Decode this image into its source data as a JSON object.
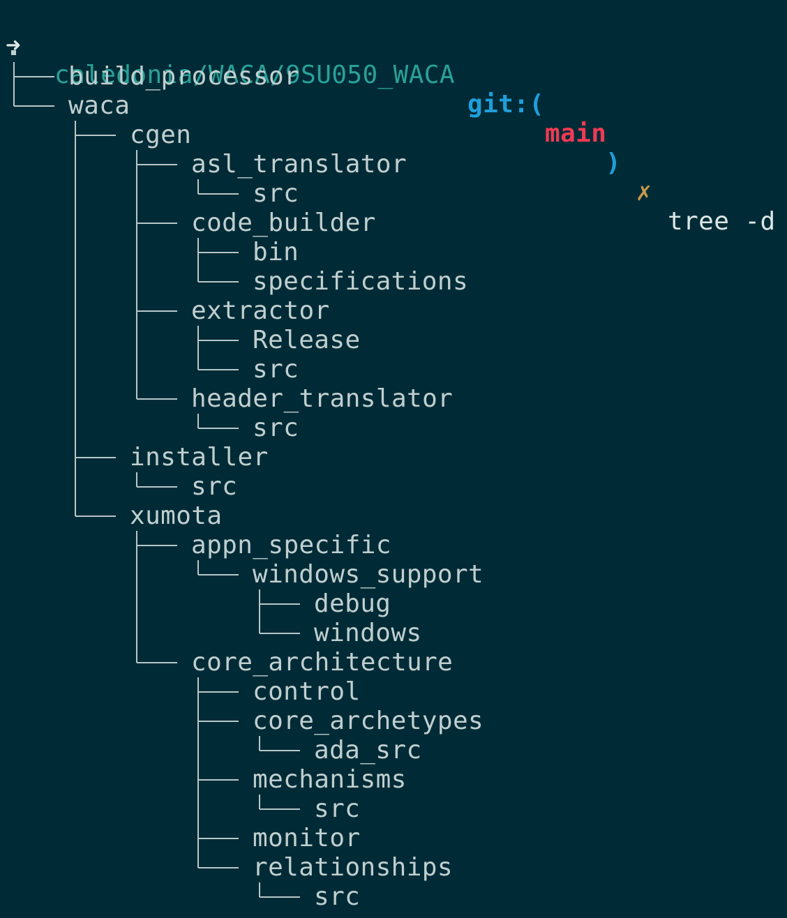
{
  "prompt": {
    "arrow": "➜",
    "path": "caledonia/WACA/9SU050_WACA",
    "git_label": "git:(",
    "branch": "main",
    "git_close": ")",
    "dirty_marker": "✗",
    "command": "tree -d"
  },
  "tree": {
    "root": ".",
    "entries": [
      {
        "depth": 0,
        "name": "build_processor",
        "last": false
      },
      {
        "depth": 0,
        "name": "waca",
        "last": true
      },
      {
        "depth": 1,
        "name": "cgen",
        "last": false
      },
      {
        "depth": 2,
        "name": "asl_translator",
        "last": false
      },
      {
        "depth": 3,
        "name": "src",
        "last": true
      },
      {
        "depth": 2,
        "name": "code_builder",
        "last": false
      },
      {
        "depth": 3,
        "name": "bin",
        "last": false
      },
      {
        "depth": 3,
        "name": "specifications",
        "last": true
      },
      {
        "depth": 2,
        "name": "extractor",
        "last": false
      },
      {
        "depth": 3,
        "name": "Release",
        "last": false
      },
      {
        "depth": 3,
        "name": "src",
        "last": true
      },
      {
        "depth": 2,
        "name": "header_translator",
        "last": true
      },
      {
        "depth": 3,
        "name": "src",
        "last": true
      },
      {
        "depth": 1,
        "name": "installer",
        "last": false
      },
      {
        "depth": 2,
        "name": "src",
        "last": true
      },
      {
        "depth": 1,
        "name": "xumota",
        "last": true
      },
      {
        "depth": 2,
        "name": "appn_specific",
        "last": false
      },
      {
        "depth": 3,
        "name": "windows_support",
        "last": true
      },
      {
        "depth": 4,
        "name": "debug",
        "last": false
      },
      {
        "depth": 4,
        "name": "windows",
        "last": true
      },
      {
        "depth": 2,
        "name": "core_architecture",
        "last": true
      },
      {
        "depth": 3,
        "name": "control",
        "last": false
      },
      {
        "depth": 3,
        "name": "core_archetypes",
        "last": false
      },
      {
        "depth": 4,
        "name": "ada_src",
        "last": true
      },
      {
        "depth": 3,
        "name": "mechanisms",
        "last": false
      },
      {
        "depth": 4,
        "name": "src",
        "last": true
      },
      {
        "depth": 3,
        "name": "monitor",
        "last": false
      },
      {
        "depth": 3,
        "name": "relationships",
        "last": true
      },
      {
        "depth": 4,
        "name": "src",
        "last": true
      }
    ]
  }
}
